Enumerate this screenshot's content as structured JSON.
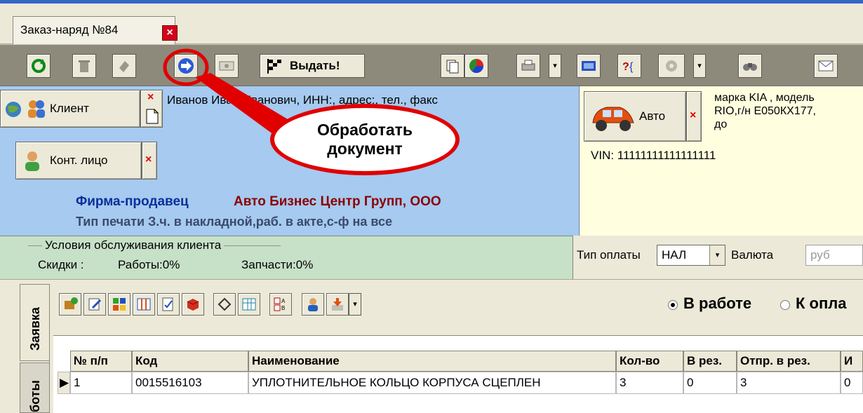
{
  "tab": {
    "title": "Заказ-наряд №84",
    "close": "×"
  },
  "toolbar": {
    "issue_label": "Выдать!",
    "dropdown_arrow": "▾"
  },
  "client": {
    "client_button": "Клиент",
    "client_info": "Иванов Иван Иванович, ИНН:, адрес:, тел., факс",
    "contact_button": "Конт. лицо",
    "clear_mark": "×",
    "firm_label": "Фирма-продавец",
    "firm_name": "Авто Бизнес Центр Групп, ООО",
    "print_type": "Тип печати З.ч. в накладной,раб. в акте,с-ф на все"
  },
  "auto": {
    "button": "Авто",
    "info_line1": "марка KIA , модель",
    "info_line2": "RIO,г/н Е050КХ177,",
    "info_line3": "до",
    "vin": "VIN: 11111111111111111"
  },
  "conditions": {
    "title": "Условия обслуживания клиента",
    "discounts": "Скидки :",
    "works": "Работы:0%",
    "parts": "Запчасти:0%"
  },
  "payment": {
    "type_label": "Тип оплаты",
    "type_value": "НАЛ",
    "currency_label": "Валюта",
    "currency_value": "руб"
  },
  "side_tabs": {
    "request": "Заявка",
    "works": "боты"
  },
  "status": {
    "in_work": "В работе",
    "to_pay": "К опла"
  },
  "grid": {
    "columns": [
      "№ п/п",
      "Код",
      "Наименование",
      "Кол-во",
      "В рез.",
      "Отпр. в рез.",
      "И"
    ],
    "row": [
      "1",
      "0015516103",
      "УПЛОТНИТЕЛЬНОЕ КОЛЬЦО КОРПУСА СЦЕПЛЕН",
      "3",
      "0",
      "3",
      "0"
    ],
    "row_marker": "▶"
  },
  "callout": {
    "line1": "Обработать",
    "line2": "документ"
  },
  "colors": {
    "client_bg": "#a6caf0",
    "auto_bg": "#ffffe0",
    "cond_bg": "#c7e0c8",
    "callout_red": "#e00000"
  }
}
